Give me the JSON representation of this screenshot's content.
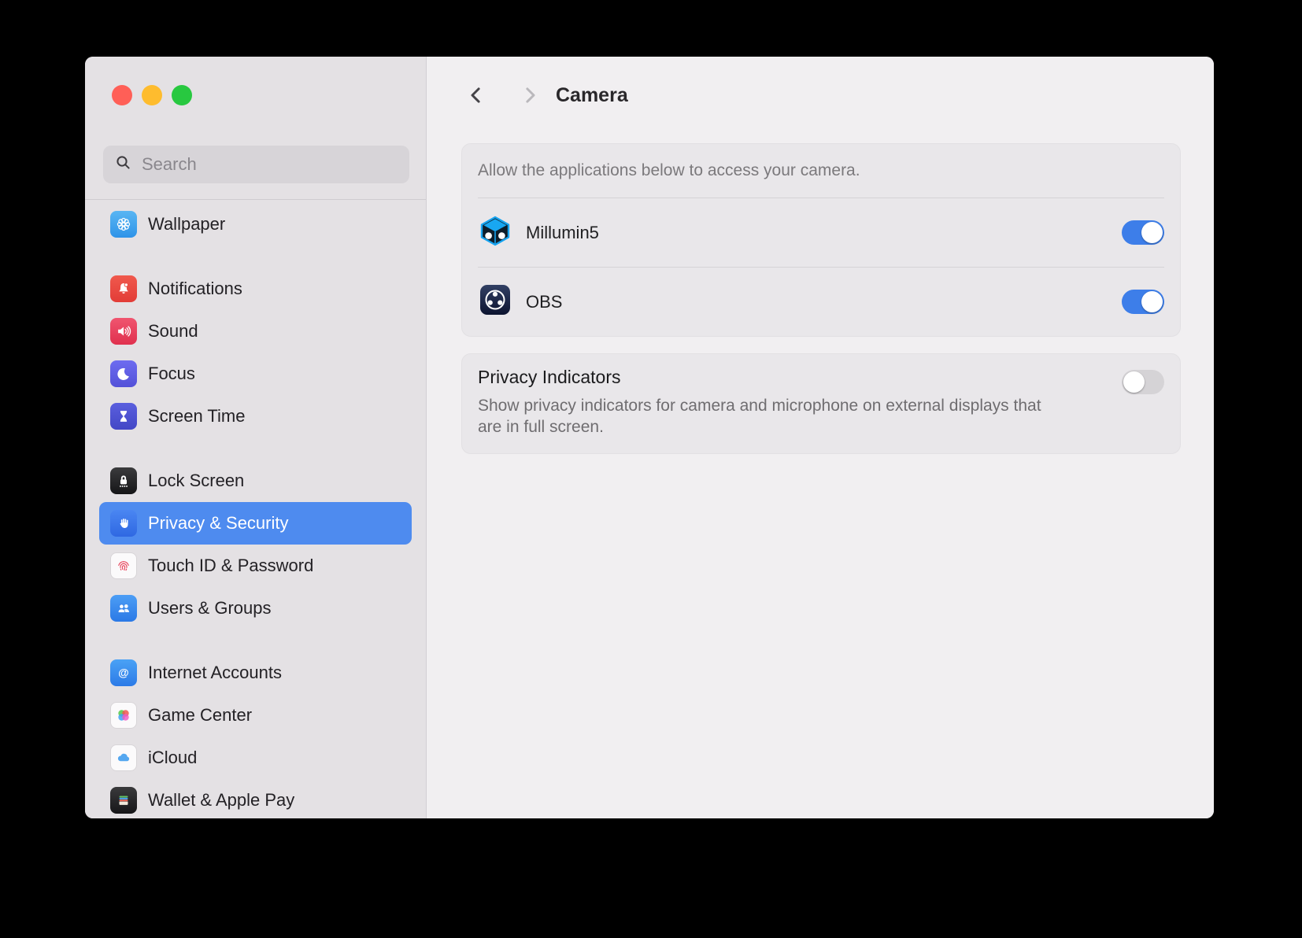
{
  "colors": {
    "accent": "#4e8bef",
    "toggleOn": "#3d7ee9",
    "toggleOffTrack": "#d5d3d6",
    "trafficRed": "#ff5f57",
    "trafficYellow": "#febc2e",
    "trafficGreen": "#28c840"
  },
  "sidebar": {
    "search": {
      "placeholder": "Search"
    },
    "groups": [
      {
        "items": [
          {
            "label": "Wallpaper",
            "icon": "wallpaper-icon"
          }
        ]
      },
      {
        "items": [
          {
            "label": "Notifications",
            "icon": "bell-icon"
          },
          {
            "label": "Sound",
            "icon": "speaker-icon"
          },
          {
            "label": "Focus",
            "icon": "moon-icon"
          },
          {
            "label": "Screen Time",
            "icon": "hourglass-icon"
          }
        ]
      },
      {
        "items": [
          {
            "label": "Lock Screen",
            "icon": "lock-icon"
          },
          {
            "label": "Privacy & Security",
            "icon": "hand-icon",
            "selected": true
          },
          {
            "label": "Touch ID & Password",
            "icon": "fingerprint-icon"
          },
          {
            "label": "Users & Groups",
            "icon": "two-people-icon"
          }
        ]
      },
      {
        "items": [
          {
            "label": "Internet Accounts",
            "icon": "at-sign-icon"
          },
          {
            "label": "Game Center",
            "icon": "game-bubbles-icon"
          },
          {
            "label": "iCloud",
            "icon": "cloud-icon"
          },
          {
            "label": "Wallet & Apple Pay",
            "icon": "wallet-icon"
          }
        ]
      }
    ]
  },
  "main": {
    "header": {
      "title": "Camera"
    },
    "camera_card": {
      "description": "Allow the applications below to access your camera.",
      "apps": [
        {
          "name": "Millumin5",
          "icon": "millumin-app-icon",
          "enabled": true
        },
        {
          "name": "OBS",
          "icon": "obs-app-icon",
          "enabled": true
        }
      ]
    },
    "privacy_card": {
      "title": "Privacy Indicators",
      "description": "Show privacy indicators for camera and microphone on external displays that are in full screen.",
      "enabled": false
    }
  }
}
